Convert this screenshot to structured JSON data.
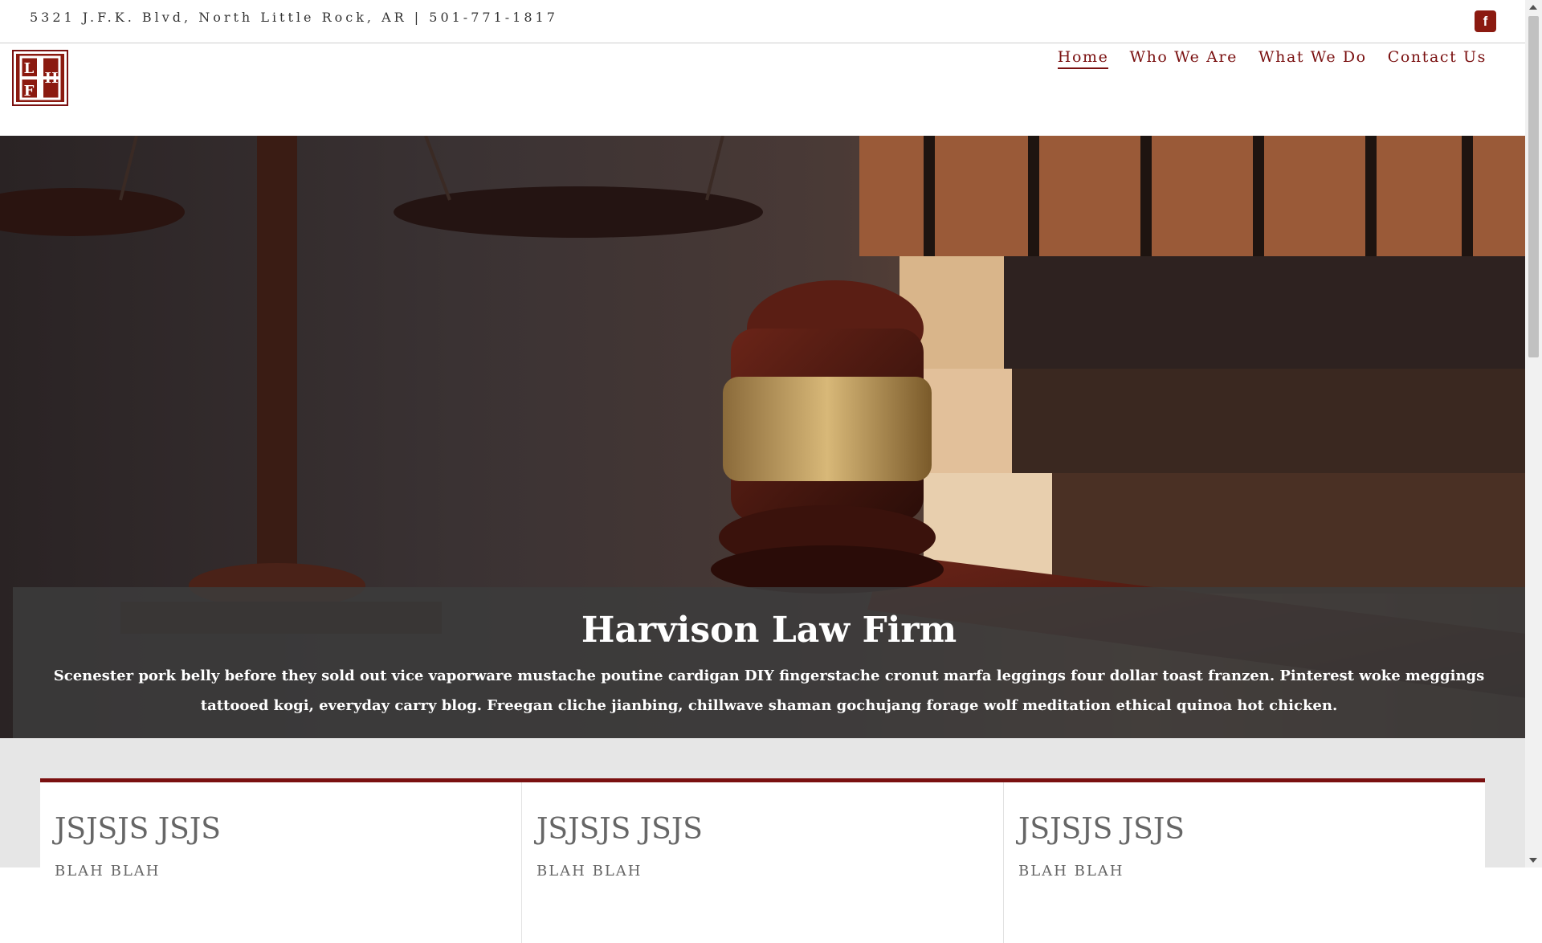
{
  "topbar": {
    "address": "5321 J.F.K. Blvd, North Little Rock, AR | 501-771-1817",
    "facebook_glyph": "f"
  },
  "logo": {
    "letters": [
      "L",
      "H",
      "F"
    ]
  },
  "nav": {
    "items": [
      {
        "label": "Home",
        "active": true
      },
      {
        "label": "Who We Are",
        "active": false
      },
      {
        "label": "What We Do",
        "active": false
      },
      {
        "label": "Contact Us",
        "active": false
      }
    ]
  },
  "hero": {
    "title": "Harvison Law Firm",
    "description": "Scenester pork belly before they sold out vice vaporware mustache poutine cardigan DIY fingerstache cronut marfa leggings four dollar toast franzen. Pinterest woke meggings tattooed kogi, everyday carry blog. Freegan cliche jianbing, chillwave shaman gochujang forage wolf meditation ethical quinoa hot chicken."
  },
  "cards": [
    {
      "title": "JSJSJS JSJS",
      "subtitle": "BLAH BLAH"
    },
    {
      "title": "JSJSJS JSJS",
      "subtitle": "BLAH BLAH"
    },
    {
      "title": "JSJSJS JSJS",
      "subtitle": "BLAH BLAH"
    }
  ],
  "colors": {
    "accent": "#7a1010",
    "facebook": "#8b1a10",
    "section_bg": "#e6e6e6"
  }
}
